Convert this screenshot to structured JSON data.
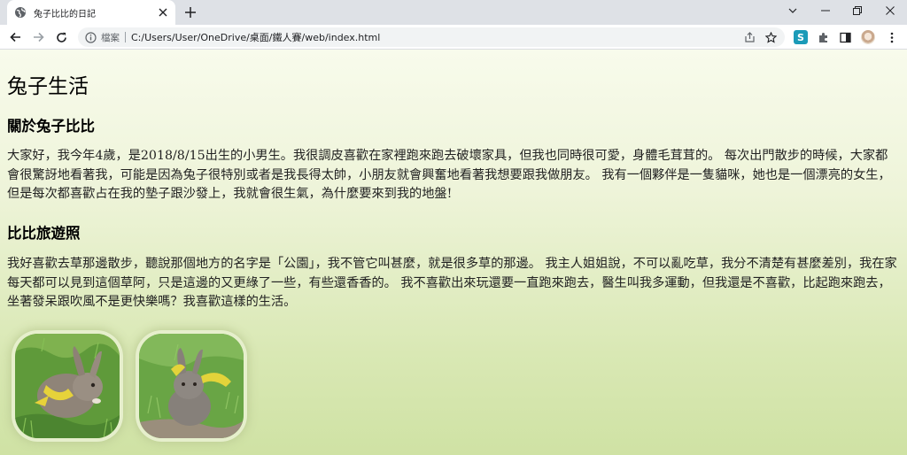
{
  "browser": {
    "tab": {
      "title": "兔子比比的日記",
      "favicon": "globe-icon",
      "close_icon": "close-icon"
    },
    "new_tab_icon": "plus-icon",
    "window_controls": [
      "chevron-down-icon",
      "minimize-icon",
      "restore-icon",
      "close-icon"
    ],
    "nav": {
      "back_icon": "arrow-left-icon",
      "forward_icon": "arrow-right-icon",
      "reload_icon": "reload-icon"
    },
    "omnibox": {
      "info_icon": "info-icon",
      "security_label": "檔案",
      "url": "C:/Users/User/OneDrive/桌面/鐵人賽/web/index.html",
      "share_icon": "share-icon",
      "bookmark_icon": "star-icon"
    },
    "extensions": {
      "s_badge": "S",
      "puzzle_icon": "puzzle-icon",
      "sidepanel_icon": "side-panel-icon",
      "avatar": "avatar",
      "menu_icon": "more-vert-icon"
    }
  },
  "page": {
    "title": "兔子生活",
    "sections": [
      {
        "heading": "關於兔子比比",
        "paragraph": "大家好，我今年4歲，是2018/8/15出生的小男生。我很調皮喜歡在家裡跑來跑去破壞家具，但我也同時很可愛，身體毛茸茸的。 每次出門散步的時候，大家都會很驚訝地看著我，可能是因為兔子很特別或者是我長得太帥，小朋友就會興奮地看著我想要跟我做朋友。 我有一個夥伴是一隻貓咪，她也是一個漂亮的女生，但是每次都喜歡占在我的墊子跟沙發上，我就會很生氣，為什麼要來到我的地盤!"
      },
      {
        "heading": "比比旅遊照",
        "paragraph": "我好喜歡去草那邊散步，聽說那個地方的名字是「公園」，我不管它叫甚麼，就是很多草的那邊。 我主人姐姐說，不可以亂吃草，我分不清楚有甚麼差別，我在家每天都可以見到這個草阿，只是這邊的又更綠了一些，有些還香香的。 我不喜歡出來玩還要一直跑來跑去，醫生叫我多運動，但我還是不喜歡，比起跑來跑去，坐著發呆跟吹風不是更快樂嗎？我喜歡這樣的生活。"
      }
    ],
    "photos": [
      {
        "subject": "rabbit-on-grass-photo"
      },
      {
        "subject": "rabbit-with-yellow-harness-photo"
      }
    ]
  },
  "colors": {
    "page_bg_top": "#f8fbec",
    "page_bg_bottom": "#cfe2a4",
    "chrome_tabstrip": "#dee1e6",
    "ext_s": "#1b9bb8"
  }
}
